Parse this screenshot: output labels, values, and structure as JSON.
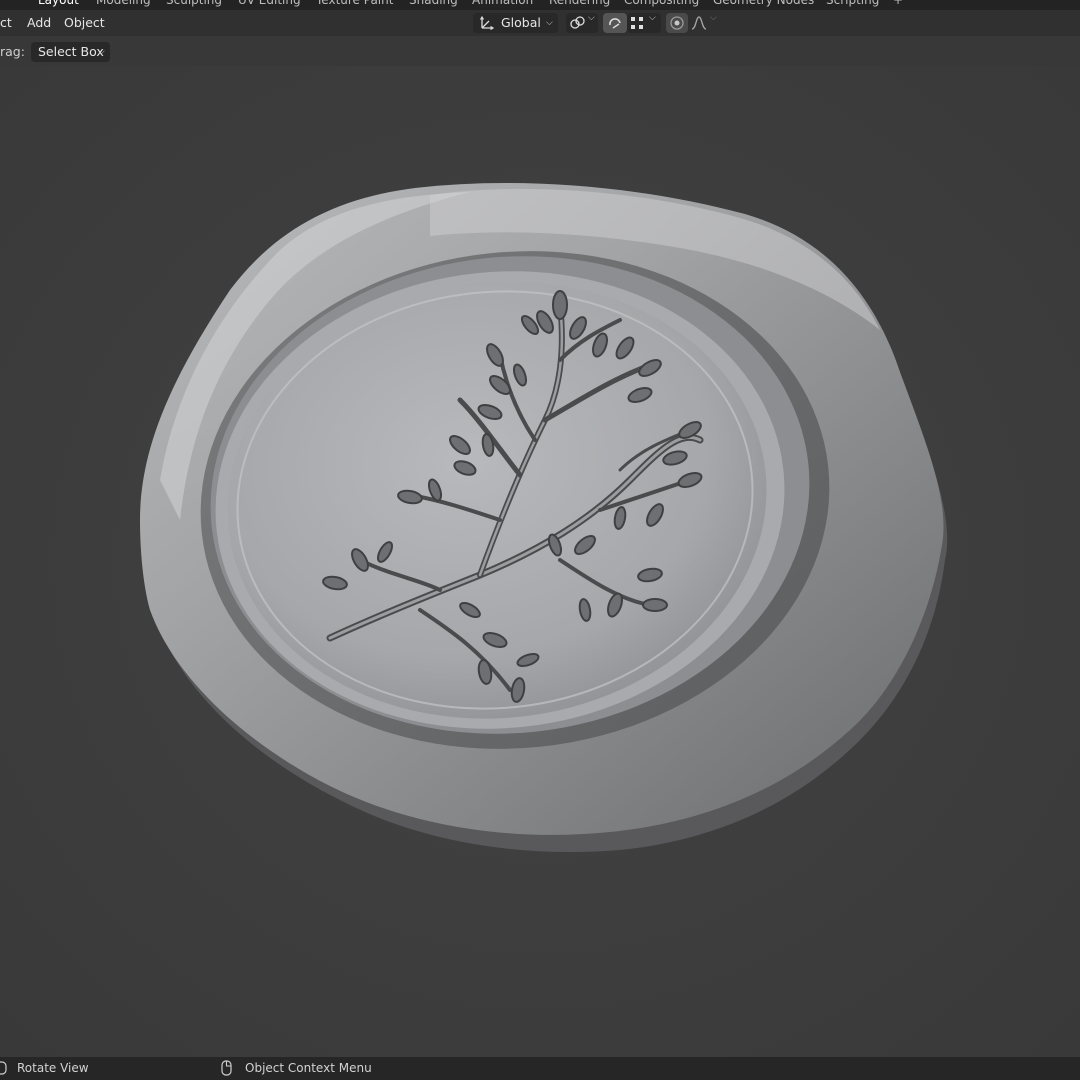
{
  "workspace_tabs": [
    "Layout",
    "Modeling",
    "Sculpting",
    "UV Editing",
    "Texture Paint",
    "Shading",
    "Animation",
    "Rendering",
    "Compositing",
    "Geometry Nodes",
    "Scripting",
    "+"
  ],
  "active_workspace": "Layout",
  "header_menu": {
    "items": [
      "ct",
      "Add",
      "Object"
    ]
  },
  "transform": {
    "orientation_value": "Global"
  },
  "tool_header": {
    "drag_label": "rag:",
    "select_mode_value": "Select Box"
  },
  "status_bar": {
    "left_hint": "Rotate View",
    "mid_hint": "Object Context Menu"
  },
  "colors": {
    "viewport_bg": "#3d3d3d",
    "header_bg": "#303030",
    "accent_active": "#555555"
  }
}
